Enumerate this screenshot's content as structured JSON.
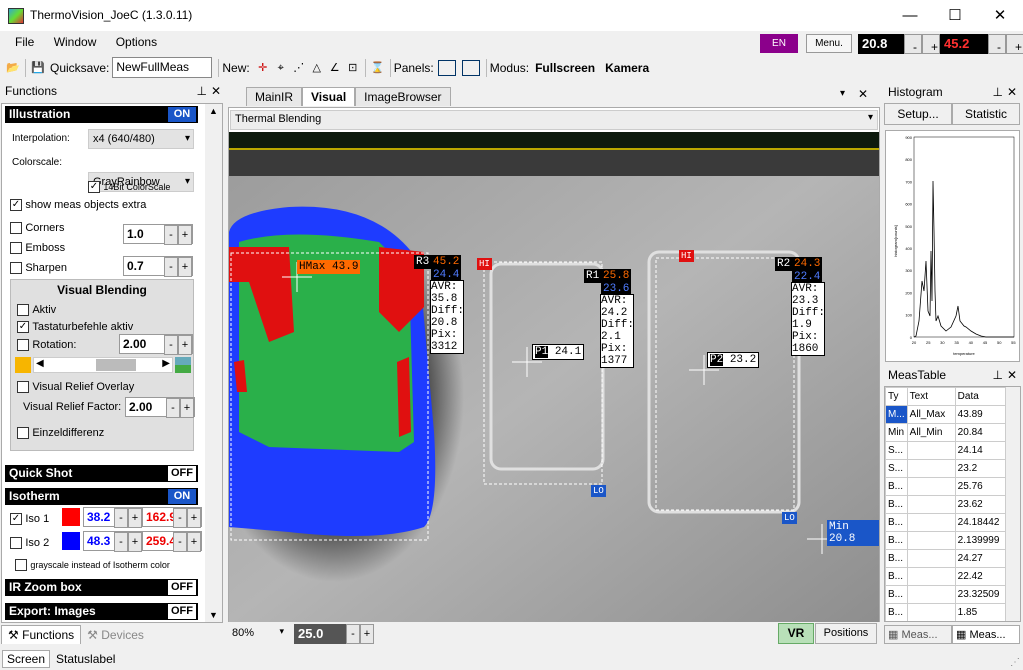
{
  "window": {
    "title": "ThermoVision_JoeC (1.3.0.11)",
    "minimize": "—",
    "maximize": "☐",
    "close": "✕"
  },
  "menu": {
    "file": "File",
    "window": "Window",
    "options": "Options"
  },
  "toolbar": {
    "quicksave_label": "Quicksave:",
    "quicksave_value": "NewFullMeas",
    "new_label": "New:",
    "panels_label": "Panels:",
    "modus_label": "Modus:",
    "fullscreen": "Fullscreen",
    "kamera": "Kamera",
    "lang_button": "EN",
    "menu_button": "Menu.",
    "temp_min": "20.8",
    "temp_max": "45.2",
    "minus": "-",
    "plus": "+"
  },
  "functions": {
    "title": "Functions",
    "illustration": {
      "title": "Illustration",
      "state": "ON",
      "interpolation_label": "Interpolation:",
      "interpolation_value": "x4 (640/480)",
      "colorscale_label": "Colorscale:",
      "colorscale_value": "GrayRainbow",
      "bit14_label": "14Bit ColorScale",
      "show_meas_label": "show meas objects extra",
      "corners_label": "Corners",
      "corners_value": "1.0",
      "emboss_label": "Emboss",
      "sharpen_label": "Sharpen",
      "sharpen_value": "0.7"
    },
    "visual_blending": {
      "title": "Visual Blending",
      "aktiv_label": "Aktiv",
      "tastatur_label": "Tastaturbefehle aktiv",
      "rotation_label": "Rotation:",
      "rotation_value": "2.00",
      "relief_overlay_label": "Visual Relief Overlay",
      "relief_factor_label": "Visual Relief Factor:",
      "relief_factor_value": "2.00",
      "einzeldiff_label": "Einzeldifferenz"
    },
    "quickshot": {
      "title": "Quick Shot",
      "state": "OFF"
    },
    "isotherm": {
      "title": "Isotherm",
      "state": "ON",
      "iso1_label": "Iso 1",
      "iso1_low": "38.2",
      "iso1_high": "162.9",
      "iso1_color": "#ff0000",
      "iso2_label": "Iso 2",
      "iso2_low": "48.3",
      "iso2_high": "259.4",
      "iso2_color": "#0000ff",
      "grayscale_label": "grayscale instead of Isotherm color"
    },
    "irzoom": {
      "title": "IR Zoom box",
      "state": "OFF"
    },
    "export": {
      "title": "Export: Images",
      "state": "OFF"
    },
    "tab_functions": "Functions",
    "tab_devices": "Devices"
  },
  "view": {
    "tabs": [
      "MainIR",
      "Visual",
      "ImageBrowser"
    ],
    "active_tab": "Visual",
    "mode_value": "Thermal Blending",
    "zoom": "80%",
    "value": "25.0",
    "vr": "VR",
    "positions": "Positions",
    "labels": {
      "r3": {
        "name": "R3",
        "max": "45.2",
        "min": "24.4",
        "stats": [
          "AVR:",
          "35.8",
          "Diff:",
          "20.8",
          "Pix:",
          "3312"
        ]
      },
      "r1": {
        "name": "R1",
        "max": "25.8",
        "min": "23.6",
        "stats": [
          "AVR:",
          "24.2",
          "Diff:",
          "2.1",
          "Pix:",
          "1377"
        ]
      },
      "r2": {
        "name": "R2",
        "max": "24.3",
        "min": "22.4",
        "stats": [
          "AVR:",
          "23.3",
          "Diff:",
          "1.9",
          "Pix:",
          "1860"
        ]
      },
      "hmax": {
        "name": "HMax",
        "value": "43.9"
      },
      "p1": {
        "name": "P1",
        "value": "24.1"
      },
      "p2": {
        "name": "P2",
        "value": "23.2"
      },
      "min": {
        "name": "Min",
        "value": "20.8"
      },
      "hi": "HI",
      "lo": "LO"
    }
  },
  "histogram": {
    "title": "Histogram",
    "setup": "Setup...",
    "statistic": "Statistic",
    "xlabel": "temperature",
    "ylabel": "histogram[counts]",
    "yticks": [
      "900",
      "800",
      "700",
      "600",
      "500",
      "400",
      "300",
      "200",
      "100",
      "0"
    ],
    "xticks": [
      "20",
      "25",
      "30",
      "35",
      "40",
      "45",
      "50",
      "55"
    ]
  },
  "meastable": {
    "title": "MeasTable",
    "headers": [
      "Ty",
      "Text",
      "Data"
    ],
    "rows": [
      [
        "M...",
        "All_Max",
        "43.89"
      ],
      [
        "Min",
        "All_Min",
        "20.84"
      ],
      [
        "S...",
        "",
        "24.14"
      ],
      [
        "S...",
        "",
        "23.2"
      ],
      [
        "B...",
        "",
        "25.76"
      ],
      [
        "B...",
        "",
        "23.62"
      ],
      [
        "B...",
        "",
        "24.18442"
      ],
      [
        "B...",
        "",
        "2.139999"
      ],
      [
        "B...",
        "",
        "24.27"
      ],
      [
        "B...",
        "",
        "22.42"
      ],
      [
        "B...",
        "",
        "23.32509"
      ],
      [
        "B...",
        "",
        "1.85"
      ]
    ],
    "tab1": "Meas...",
    "tab2": "Meas..."
  },
  "status": {
    "screen": "Screen",
    "label": "Statuslabel"
  },
  "colors": {
    "accent": "#1a56c8",
    "on": "#1a56c8",
    "lang": "#8b008b"
  }
}
